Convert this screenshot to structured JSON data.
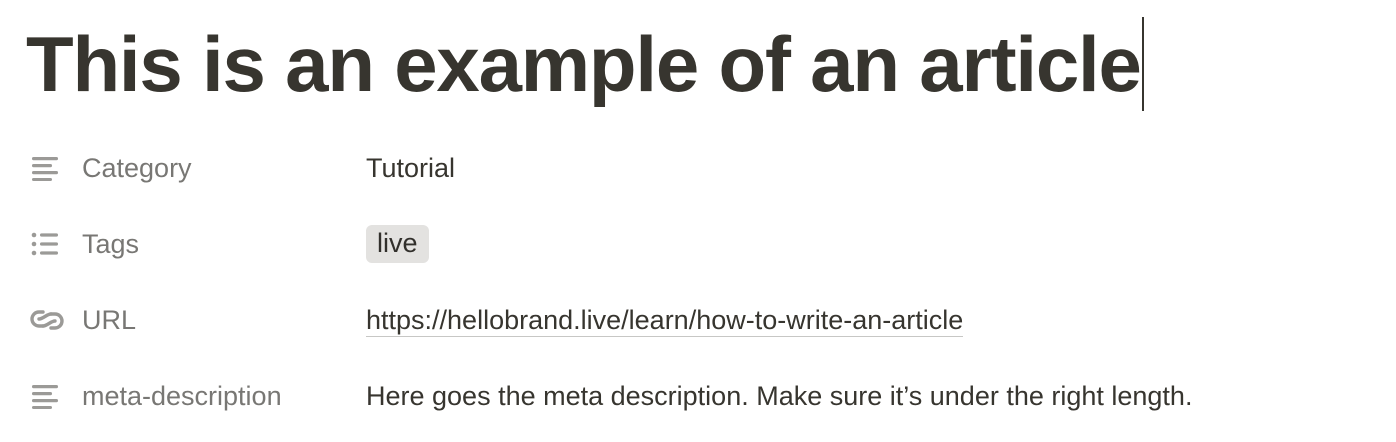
{
  "page": {
    "title": "This is an example of an article"
  },
  "properties": [
    {
      "icon": "text-lines-icon",
      "label": "Category",
      "value": "Tutorial"
    },
    {
      "icon": "bulleted-list-icon",
      "label": "Tags",
      "value": "live"
    },
    {
      "icon": "link-icon",
      "label": "URL",
      "value": "https://hellobrand.live/learn/how-to-write-an-article"
    },
    {
      "icon": "text-lines-icon",
      "label": "meta-description",
      "value": "Here goes the meta description. Make sure it’s under the right length."
    }
  ],
  "colors": {
    "text": "#37352f",
    "label": "#787774",
    "icon": "#9b9a97",
    "tag_bg": "#e3e2e0"
  }
}
